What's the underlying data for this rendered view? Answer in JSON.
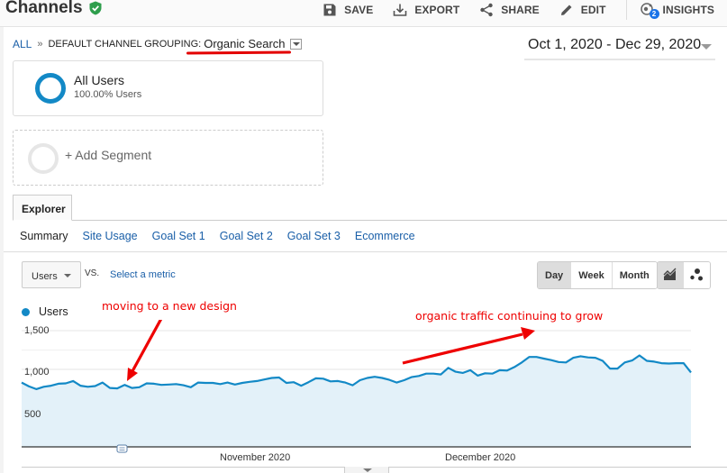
{
  "header": {
    "title": "Channels",
    "verified_icon": "check-shield-icon",
    "actions": [
      {
        "label": "SAVE",
        "icon": "save-icon"
      },
      {
        "label": "EXPORT",
        "icon": "export-icon"
      },
      {
        "label": "SHARE",
        "icon": "share-icon"
      },
      {
        "label": "EDIT",
        "icon": "edit-icon"
      },
      {
        "label": "INSIGHTS",
        "icon": "insights-icon",
        "badge": "2"
      }
    ]
  },
  "breadcrumb": {
    "root": "ALL",
    "separator": "»",
    "grouping_label": "DEFAULT CHANNEL GROUPING:",
    "grouping_value": "Organic Search"
  },
  "date_range": "Oct 1, 2020 - Dec 29, 2020",
  "segments": {
    "active": {
      "name": "All Users",
      "sub": "100.00% Users"
    },
    "add_label": "+ Add Segment"
  },
  "tabs": {
    "main": "Explorer",
    "sub": [
      "Summary",
      "Site Usage",
      "Goal Set 1",
      "Goal Set 2",
      "Goal Set 3",
      "Ecommerce"
    ],
    "active_sub": "Summary"
  },
  "metric_controls": {
    "metric": "Users",
    "vs": "VS.",
    "select_metric": "Select a metric",
    "granularity": [
      "Day",
      "Week",
      "Month"
    ],
    "active_granularity": "Day",
    "chart_types": [
      "line-chart-icon",
      "motion-chart-icon"
    ]
  },
  "annotations": {
    "left": "moving to a new design",
    "right": "organic traffic continuing to grow"
  },
  "colors": {
    "accent": "#1389c6",
    "area_fill": "#e3f1f9",
    "annotation_red": "#e00000",
    "link": "#1a5fa8"
  },
  "chart_data": {
    "type": "area",
    "series": [
      {
        "name": "Users",
        "values": [
          830,
          780,
          745,
          775,
          790,
          815,
          820,
          850,
          790,
          775,
          785,
          830,
          760,
          755,
          800,
          760,
          770,
          820,
          815,
          800,
          805,
          810,
          795,
          770,
          830,
          825,
          825,
          810,
          830,
          805,
          825,
          840,
          850,
          870,
          890,
          895,
          825,
          835,
          790,
          835,
          885,
          880,
          845,
          850,
          830,
          795,
          860,
          890,
          905,
          890,
          865,
          830,
          860,
          900,
          915,
          945,
          945,
          935,
          1020,
          970,
          955,
          990,
          920,
          950,
          945,
          990,
          985,
          1030,
          1090,
          1160,
          1160,
          1140,
          1120,
          1095,
          1090,
          1150,
          1170,
          1155,
          1150,
          1110,
          1010,
          1010,
          1090,
          1115,
          1180,
          1110,
          1100,
          1080,
          1075,
          1080,
          1080,
          960
        ]
      }
    ],
    "x_tick_labels": [
      "November 2020",
      "December 2020"
    ],
    "y_tick_labels": [
      "500",
      "1,000",
      "1,500"
    ],
    "ylim": [
      0,
      1650
    ],
    "xlabel": "",
    "ylabel": "",
    "grid": true,
    "legend": "top-left"
  }
}
